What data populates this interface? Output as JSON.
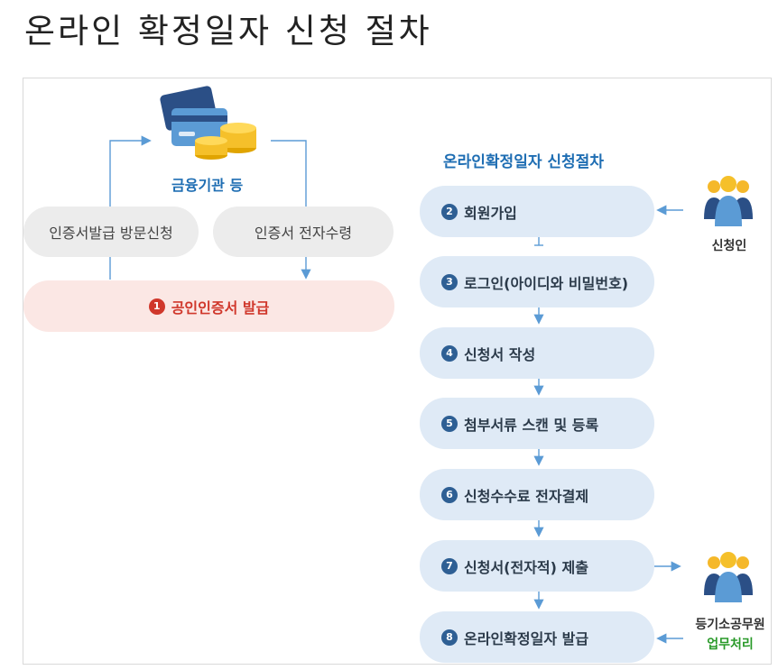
{
  "title": "온라인 확정일자 신청 절차",
  "left": {
    "institution_label": "금융기관 등",
    "visit_label": "인증서발급 방문신청",
    "receive_label": "인증서 전자수령",
    "issue": {
      "num": "1",
      "label": "공인인증서 발급"
    }
  },
  "right": {
    "heading": "온라인확정일자 신청절차",
    "steps": [
      {
        "num": "2",
        "label": "회원가입"
      },
      {
        "num": "3",
        "label": "로그인(아이디와 비밀번호)"
      },
      {
        "num": "4",
        "label": "신청서 작성"
      },
      {
        "num": "5",
        "label": "첨부서류 스캔 및 등록"
      },
      {
        "num": "6",
        "label": "신청수수료 전자결제"
      },
      {
        "num": "7",
        "label": "신청서(전자적) 제출"
      },
      {
        "num": "8",
        "label": "온라인확정일자 발급"
      }
    ],
    "applicant_label": "신청인",
    "officer_label": "등기소공무원",
    "officer_sub": "업무처리"
  },
  "colors": {
    "accent_blue": "#1f6eb3",
    "accent_red": "#d0372b",
    "step_bg": "#dfeaf6"
  }
}
